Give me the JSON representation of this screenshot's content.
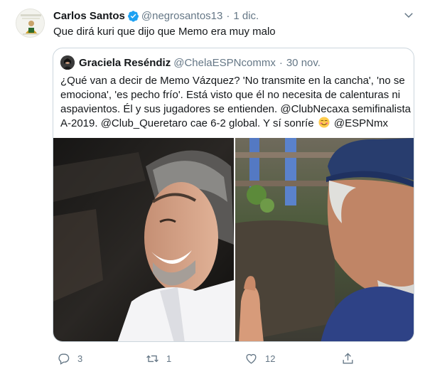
{
  "tweet": {
    "author_name": "Carlos Santos",
    "handle": "@negrosantos13",
    "separator": "·",
    "date": "1 dic.",
    "text": "Que dirá kuri que dijo que Memo era muy malo"
  },
  "quoted": {
    "author_name": "Graciela Reséndiz",
    "handle": "@ChelaESPNcommx",
    "separator": "·",
    "date": "30 nov.",
    "text_lines": [
      "¿Qué van a decir de Memo Vázquez? 'No transmite en la cancha', 'no se",
      "emociona', 'es pecho frío'. Está visto que él no necesita de calenturas ni",
      "aspavientos. Él y sus jugadores se entienden. @ClubNecaxa semifinalista",
      "A-2019. @Club_Queretaro cae 6-2 global. Y sí sonríe",
      "@ESPNmx"
    ]
  },
  "actions": {
    "replies": "3",
    "retweets": "1",
    "likes": "12"
  },
  "icons": {
    "verified": "verified-badge-icon",
    "caret": "chevron-down-icon",
    "reply": "reply-icon",
    "retweet": "retweet-icon",
    "like": "heart-icon",
    "share": "share-icon",
    "emoji": "smiling-face-emoji"
  },
  "colors": {
    "accent": "#1da1f2",
    "muted": "#657786",
    "border": "#ccd6dd",
    "text": "#14171a"
  }
}
